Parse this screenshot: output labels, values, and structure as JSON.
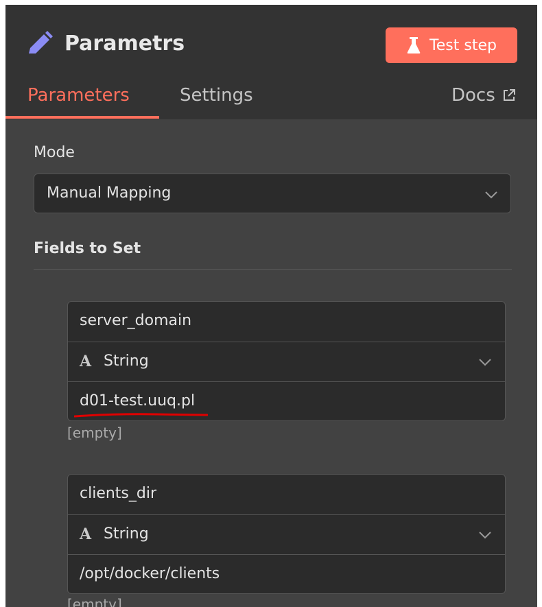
{
  "header": {
    "title": "Parametrs",
    "title_icon": "pencil-icon",
    "test_button_label": "Test step",
    "test_button_icon": "flask-icon"
  },
  "tabs": [
    {
      "label": "Parameters",
      "active": true
    },
    {
      "label": "Settings",
      "active": false
    },
    {
      "label": "Docs",
      "active": false,
      "icon": "external-link-icon"
    }
  ],
  "mode": {
    "label": "Mode",
    "value": "Manual Mapping"
  },
  "fields_section": {
    "title": "Fields to Set"
  },
  "fields": [
    {
      "name": "server_domain",
      "type_icon": "A",
      "type": "String",
      "value": "d01-test.uuq.pl",
      "hint": "[empty]"
    },
    {
      "name": "clients_dir",
      "type_icon": "A",
      "type": "String",
      "value": "/opt/docker/clients",
      "hint": "[empty]"
    }
  ],
  "colors": {
    "accent": "#ff6f5c",
    "pencil": "#8b8cf4",
    "panel_bg": "#424242",
    "header_bg": "#333333",
    "input_bg": "#2b2b2b",
    "annotation": "#e00000"
  }
}
